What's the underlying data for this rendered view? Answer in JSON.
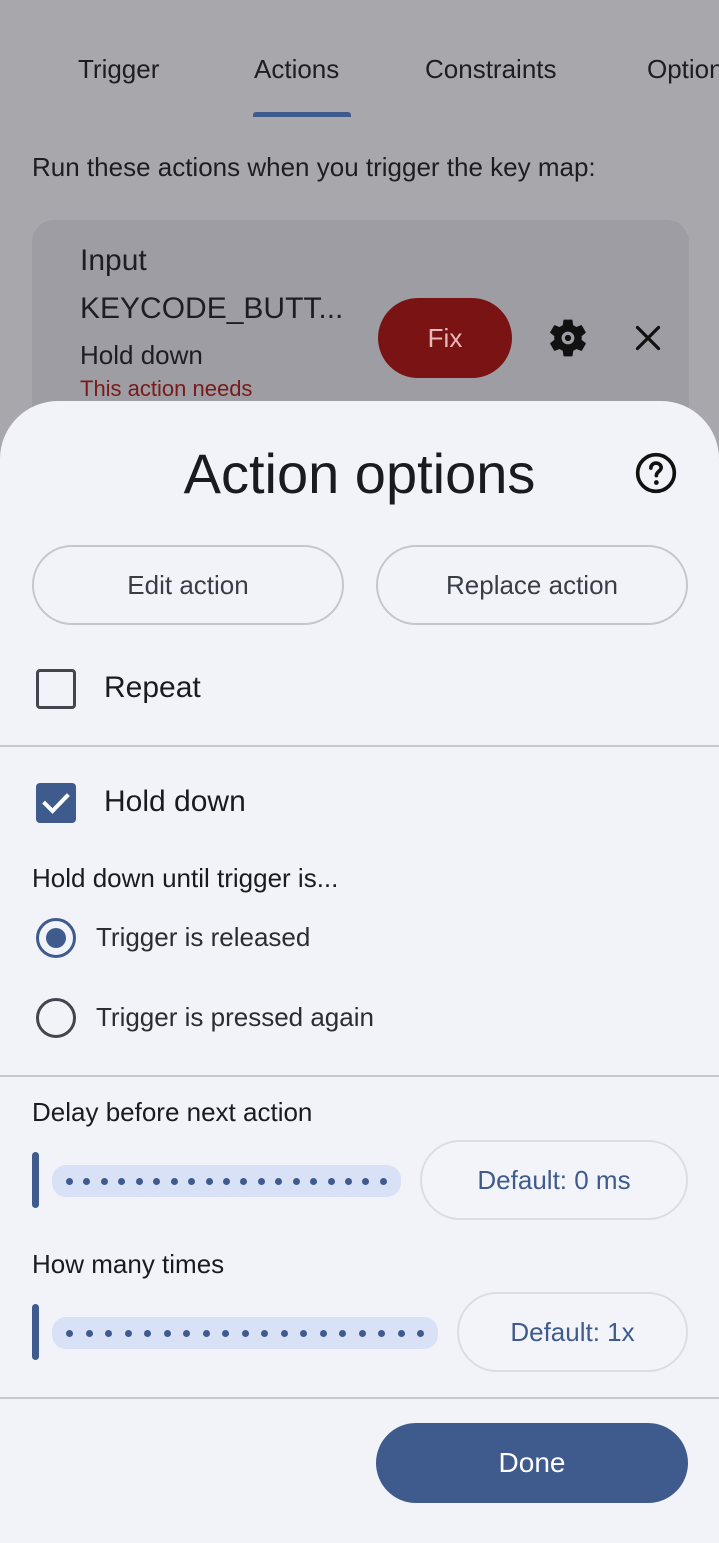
{
  "tabs": [
    {
      "label": "Trigger"
    },
    {
      "label": "Actions"
    },
    {
      "label": "Constraints"
    },
    {
      "label": "Options"
    }
  ],
  "run_text": "Run these actions when you trigger the key map:",
  "action_card": {
    "title_line1": "Input",
    "title_line2": "KEYCODE_BUTT...",
    "subtitle": "Hold down",
    "warning": "This action needs",
    "fix_label": "Fix"
  },
  "sheet": {
    "title": "Action options",
    "edit_label": "Edit action",
    "replace_label": "Replace action",
    "repeat_label": "Repeat",
    "repeat_checked": false,
    "hold_down_label": "Hold down",
    "hold_down_checked": true,
    "hold_until_label": "Hold down until trigger is...",
    "radio_options": [
      {
        "label": "Trigger is released",
        "selected": true
      },
      {
        "label": "Trigger is pressed again",
        "selected": false
      }
    ],
    "delay_label": "Delay before next action",
    "delay_default": "Default: 0 ms",
    "times_label": "How many times",
    "times_default": "Default: 1x",
    "done_label": "Done"
  },
  "colors": {
    "accent": "#3f5a8c",
    "fix_bg": "#7a1414",
    "warning_text": "#7a1a1a"
  }
}
